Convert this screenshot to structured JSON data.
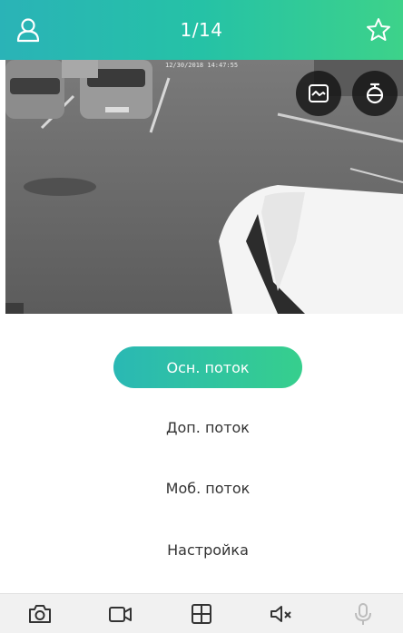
{
  "header": {
    "title": "1/14",
    "left_icon": "user-icon",
    "right_icon": "star-icon"
  },
  "video": {
    "timestamp": "12/30/2018 14:47:55",
    "overlay_buttons": [
      "picture-mode-icon",
      "ptz-dome-camera-icon"
    ]
  },
  "streams": {
    "options": [
      "Осн. поток",
      "Доп. поток",
      "Моб. поток",
      "Настройка"
    ],
    "selected": "Осн. поток"
  },
  "toolbar": {
    "items": [
      "snapshot-camera-icon",
      "record-video-icon",
      "multi-view-grid-icon",
      "mute-speaker-icon",
      "microphone-icon"
    ]
  },
  "colors": {
    "accent_start": "#2ab3b7",
    "accent_end": "#3dd28a",
    "toolbar_bg": "#f1f1f1",
    "text": "#333333"
  }
}
